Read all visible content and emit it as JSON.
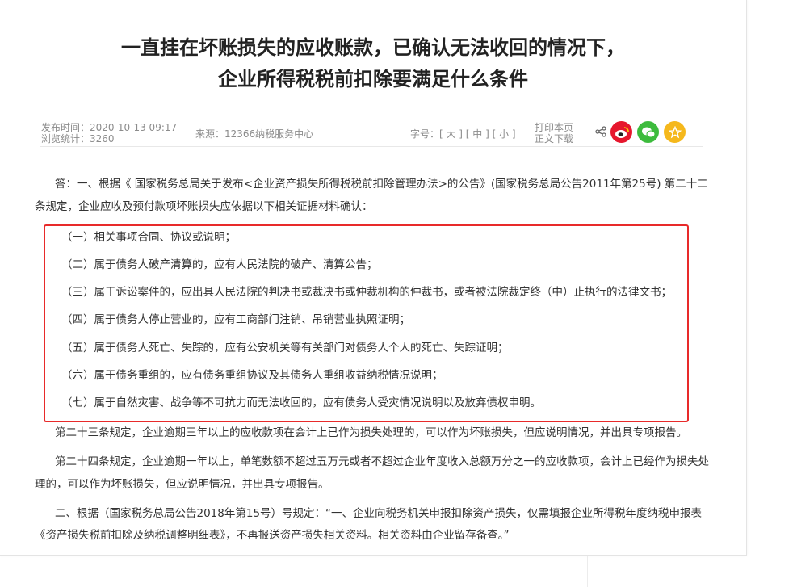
{
  "article": {
    "title_line1": "一直挂在坏账损失的应收账款，已确认无法收回的情况下，",
    "title_line2": "企业所得税税前扣除要满足什么条件"
  },
  "meta": {
    "publish_time": "发布时间：2020-10-13 09:17",
    "views": "浏览统计：3260",
    "source": "来源：12366纳税服务中心",
    "font_size": "字号：[ 大 ] [ 中 ] [ 小 ]",
    "print": "打印本页",
    "download": "正文下载"
  },
  "share": {
    "icons": [
      "share-icon",
      "weibo-icon",
      "wechat-icon",
      "favorite-icon"
    ],
    "colors": {
      "weibo": "#e6162d",
      "wechat": "#3dbb3d",
      "favorite": "#f5b81c"
    }
  },
  "body": {
    "intro_line1": "答：一、根据《 国家税务总局关于发布<企业资产损失所得税税前扣除管理办法>的公告》(国家税务总局公告2011年第25号) 第二十二",
    "intro_line2": "条规定，企业应收及预付款项坏账损失应依据以下相关证据材料确认：",
    "items": [
      "（一）相关事项合同、协议或说明；",
      "（二）属于债务人破产清算的，应有人民法院的破产、清算公告；",
      "（三）属于诉讼案件的，应出具人民法院的判决书或裁决书或仲裁机构的仲裁书，或者被法院裁定终（中）止执行的法律文书；",
      "（四）属于债务人停止营业的，应有工商部门注销、吊销营业执照证明；",
      "（五）属于债务人死亡、失踪的，应有公安机关等有关部门对债务人个人的死亡、失踪证明；",
      "（六）属于债务重组的，应有债务重组协议及其债务人重组收益纳税情况说明；",
      "（七）属于自然灾害、战争等不可抗力而无法收回的，应有债务人受灾情况说明以及放弃债权申明。"
    ],
    "art23": "第二十三条规定，企业逾期三年以上的应收款项在会计上已作为损失处理的，可以作为坏账损失，但应说明情况，并出具专项报告。",
    "art24_line1": "第二十四条规定，企业逾期一年以上，单笔数额不超过五万元或者不超过企业年度收入总额万分之一的应收款项，会计上已经作为损失处",
    "art24_line2": "理的，可以作为坏账损失，但应说明情况，并出具专项报告。",
    "part2_line1": "二、根据（国家税务总局公告2018年第15号）号规定：“一、企业向税务机关申报扣除资产损失，仅需填报企业所得税年度纳税申报表",
    "part2_line2": "《资产损失税前扣除及纳税调整明细表》，不再报送资产损失相关资料。相关资料由企业留存备查。”"
  }
}
